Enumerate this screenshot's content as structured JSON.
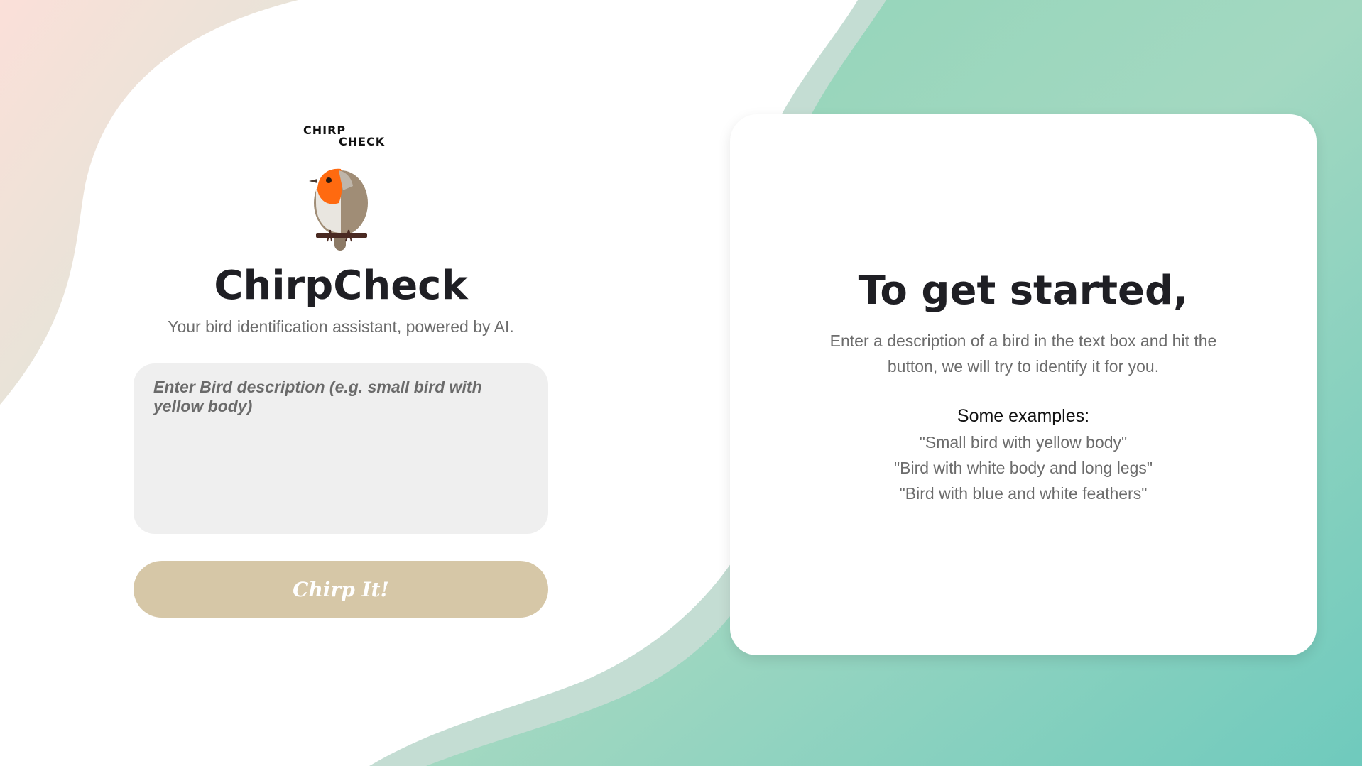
{
  "app": {
    "logo_line1": "CHIRP",
    "logo_line2": "CHECK",
    "title": "ChirpCheck",
    "subtitle": "Your bird identification assistant, powered by AI."
  },
  "input": {
    "placeholder": "Enter Bird description (e.g. small bird with yellow body)",
    "value": ""
  },
  "button": {
    "label": "Chirp It!"
  },
  "card": {
    "title": "To get started,",
    "text": "Enter a description of a bird in the text box and hit the button, we will try to identify it for you.",
    "examples_heading": "Some examples:",
    "examples": [
      "\"Small bird with yellow body\"",
      "\"Bird with white body and long legs\"",
      "\"Bird with blue and white feathers\""
    ]
  },
  "colors": {
    "button_bg": "#d6c7a7",
    "input_bg": "#efefef",
    "wave_green": "#8fd0b6",
    "wave_teal": "#74cbbf",
    "corner_pink": "#f7dcd3",
    "bird_orange": "#ff6a10",
    "bird_brown": "#a08d76"
  },
  "icons": {
    "logo": "robin-bird-icon"
  }
}
